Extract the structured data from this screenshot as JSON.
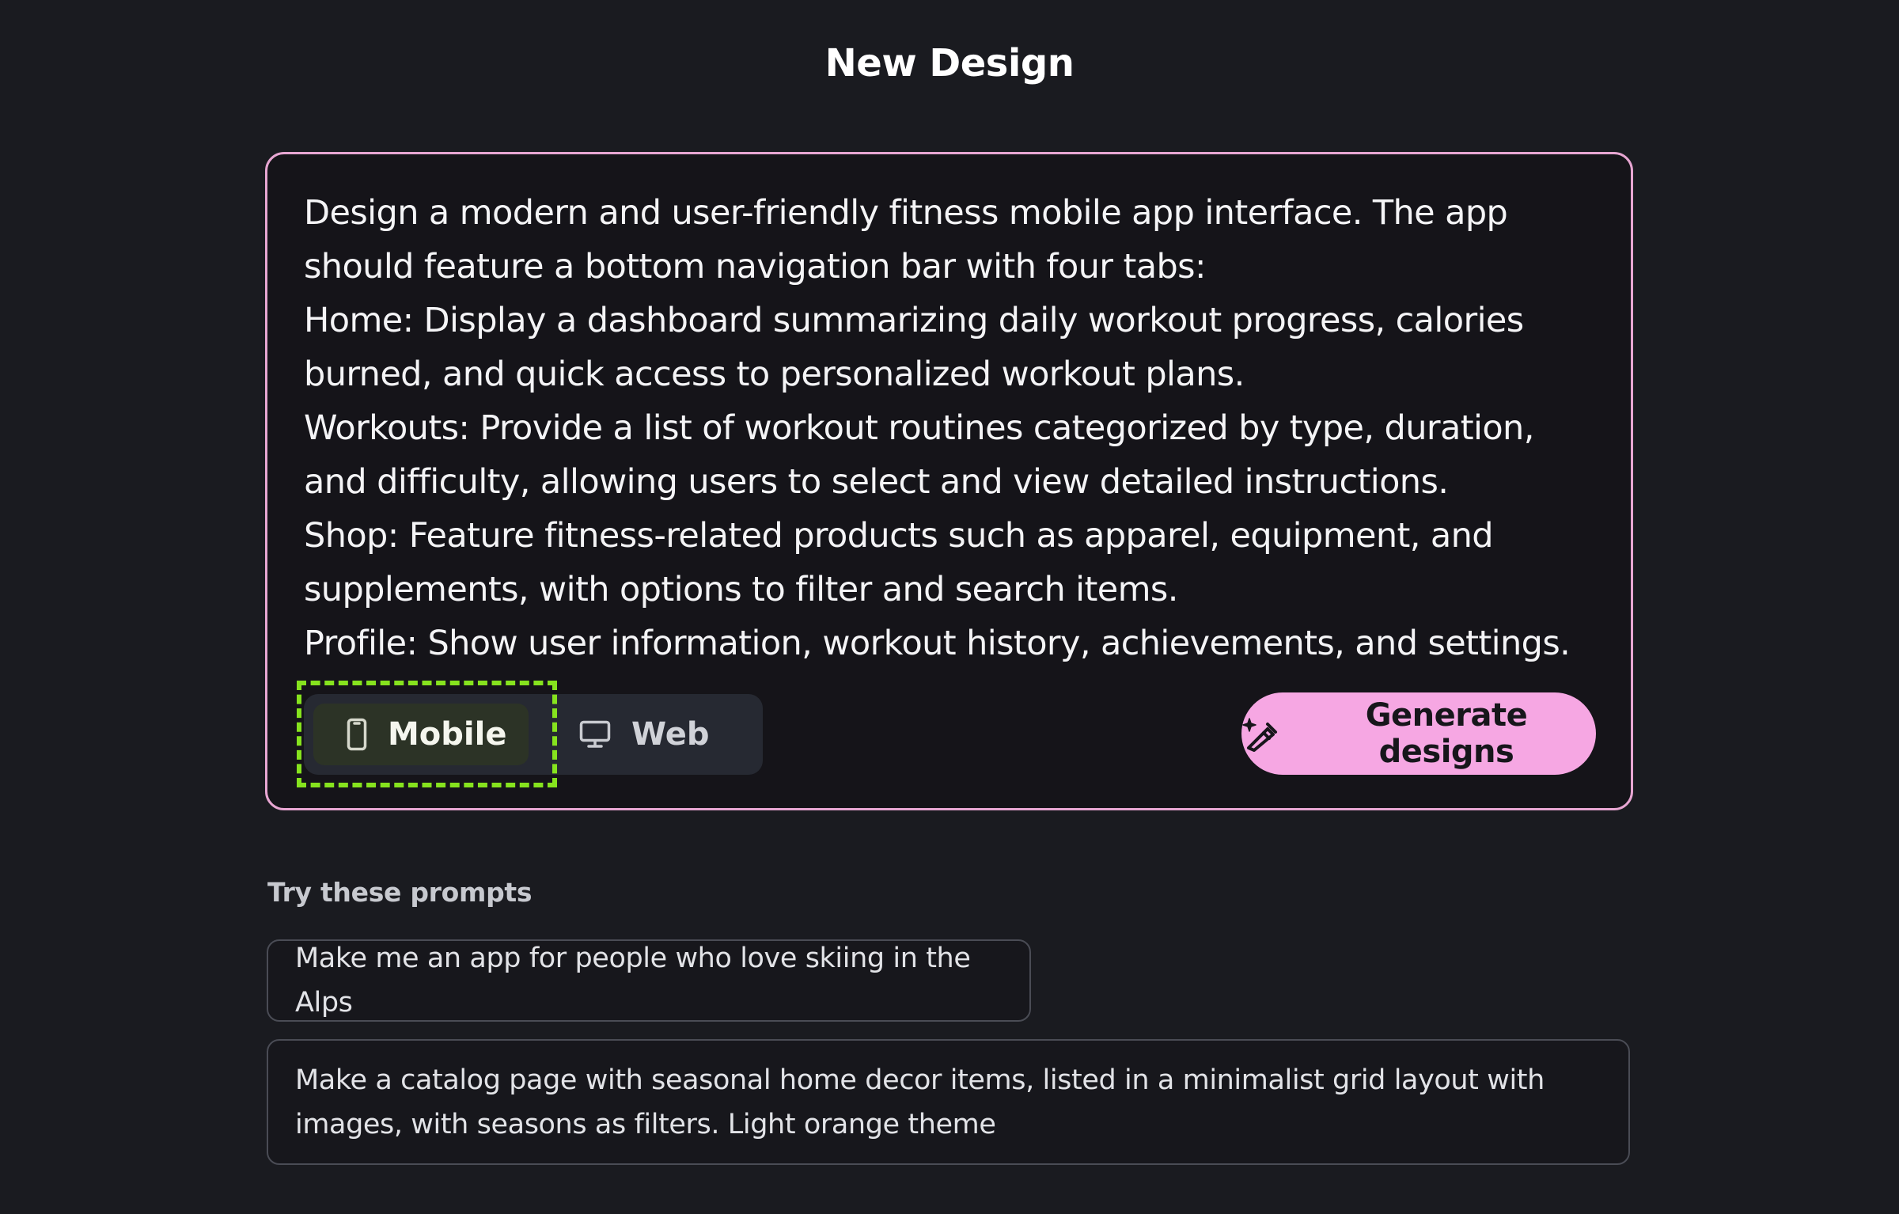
{
  "page": {
    "title": "New Design"
  },
  "prompt": {
    "text": "Design a modern and user-friendly fitness mobile app interface. The app should feature a bottom navigation bar with four tabs:\nHome: Display a dashboard summarizing daily workout progress, calories burned, and quick access to personalized workout plans.\nWorkouts: Provide a list of workout routines categorized by type, duration, and difficulty, allowing users to select and view detailed instructions.\nShop: Feature fitness-related products such as apparel, equipment, and supplements, with options to filter and search items.\nProfile: Show user information, workout history, achievements, and settings."
  },
  "platform": {
    "selected": "Mobile",
    "options": [
      {
        "label": "Mobile",
        "icon": "smartphone-icon"
      },
      {
        "label": "Web",
        "icon": "monitor-icon"
      }
    ]
  },
  "generate": {
    "label": "Generate designs",
    "icon": "magic-wand-icon"
  },
  "suggestions": {
    "heading": "Try these prompts",
    "items": [
      "Make me an app for people who love skiing in the Alps",
      "Make a catalog page with seasonal home decor items, listed in a minimalist grid layout with images, with seasons as filters. Light orange theme"
    ]
  },
  "colors": {
    "background": "#1a1b20",
    "card_border": "#e7a6d2",
    "accent_button": "#f6a7e3",
    "focus_outline": "#86e31e"
  }
}
